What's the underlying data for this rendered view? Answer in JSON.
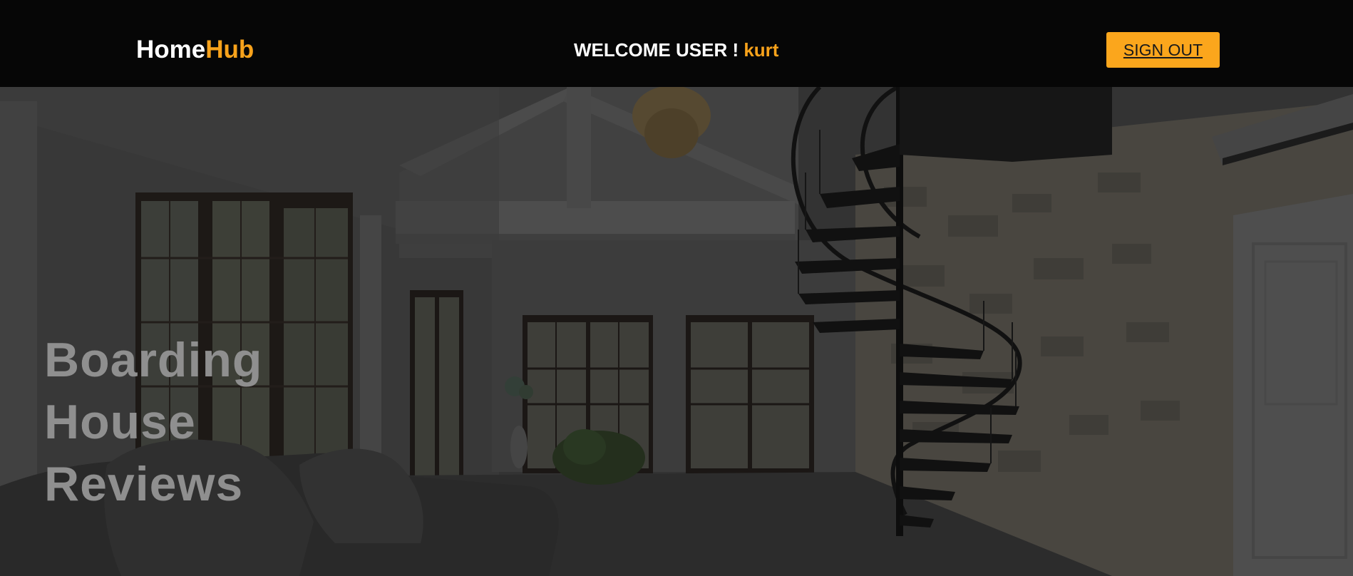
{
  "header": {
    "logo_home": "Home",
    "logo_hub": "Hub",
    "welcome_prefix": "WELCOME USER ! ",
    "username": "kurt",
    "signout_label": "SIGN OUT"
  },
  "hero": {
    "title_line1": "Boarding",
    "title_line2": "House",
    "title_line3": "Reviews"
  },
  "colors": {
    "accent": "#f7a21b",
    "button": "#fba61c",
    "navbar": "#060606",
    "hero_title": "#8f8f8f"
  }
}
